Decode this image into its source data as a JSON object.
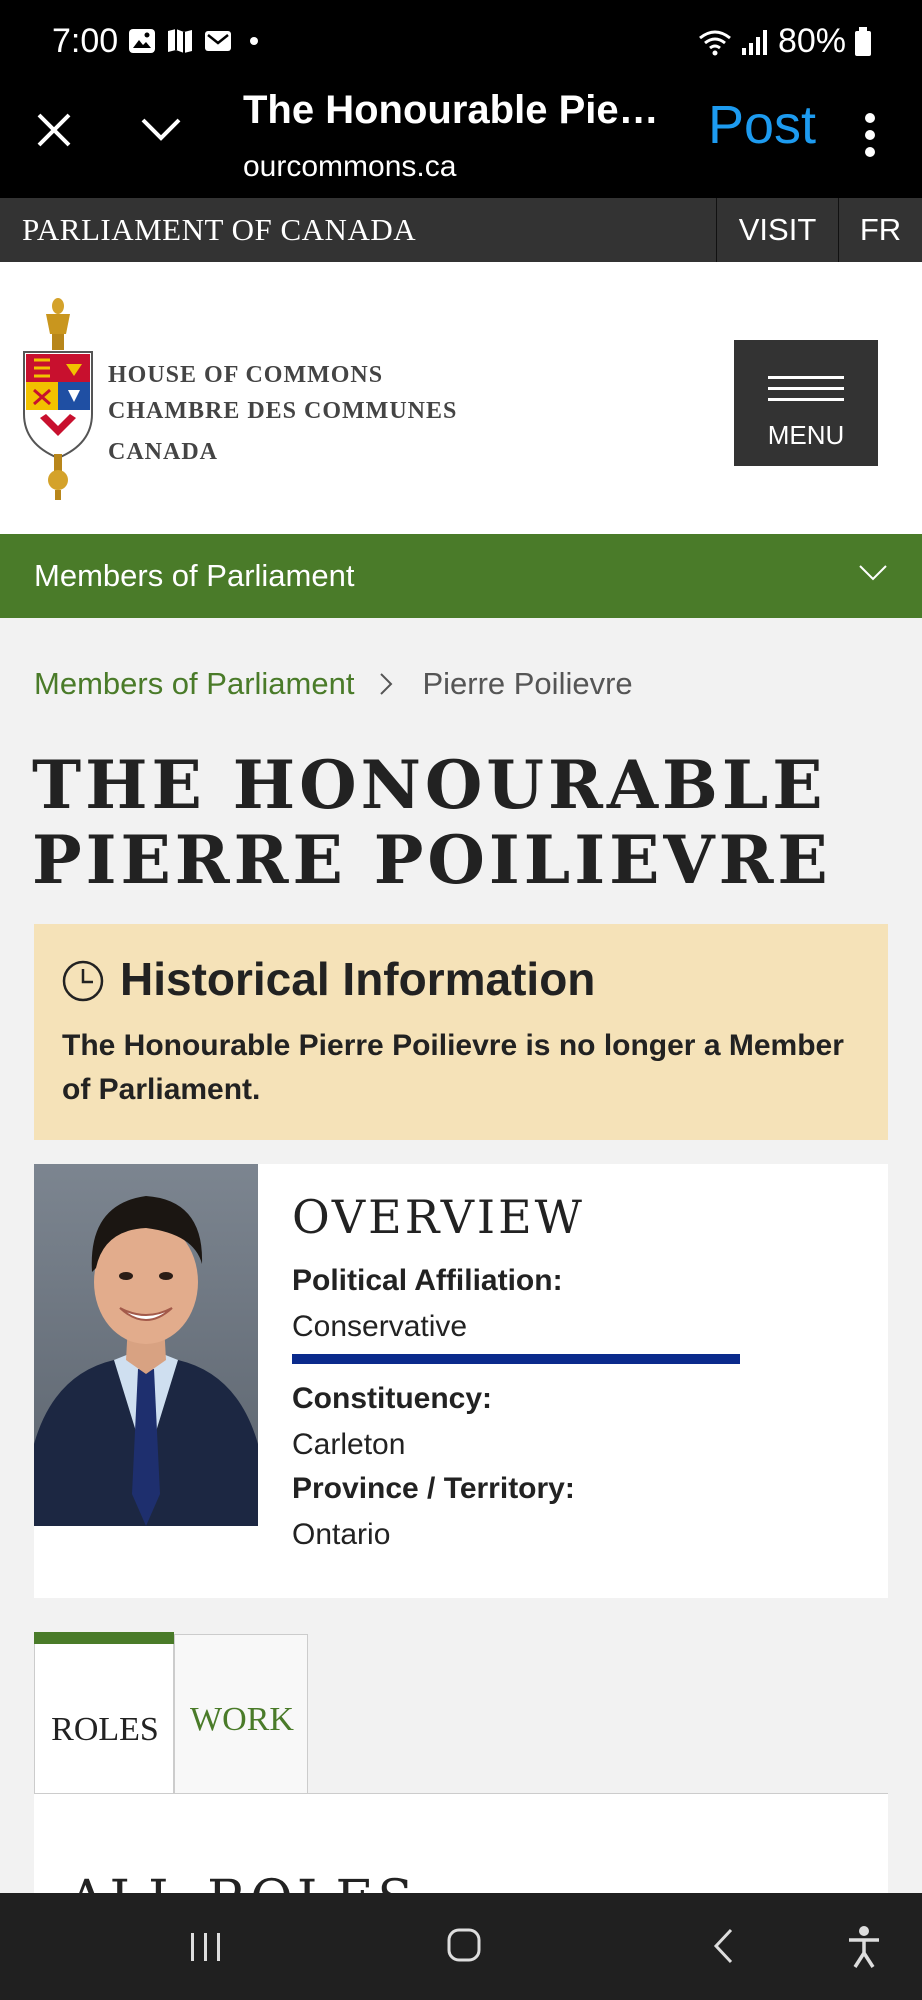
{
  "status_bar": {
    "time": "7:00",
    "battery": "80%",
    "icons": [
      "gallery-icon",
      "map-icon",
      "mail-icon",
      "wifi-icon",
      "signal-icon",
      "battery-icon"
    ]
  },
  "browser": {
    "page_title": "The Honourable Pierr...",
    "domain": "ourcommons.ca",
    "post_label": "Post",
    "accent_color": "#1d9bf0"
  },
  "parliament_bar": {
    "title": "PARLIAMENT OF CANADA",
    "visit_label": "VISIT",
    "lang_label": "FR"
  },
  "header": {
    "line1": "HOUSE OF COMMONS",
    "line2": "CHAMBRE DES COMMUNES",
    "line3": "CANADA",
    "menu_label": "MENU"
  },
  "section_nav": {
    "label": "Members of Parliament",
    "color": "#4a7b29"
  },
  "breadcrumb": {
    "parent": "Members of Parliament",
    "current": "Pierre Poilievre"
  },
  "page": {
    "title_line1": "THE HONOURABLE",
    "title_line2": "PIERRE POILIEVRE"
  },
  "historical": {
    "title": "Historical Information",
    "text": "The Honourable Pierre Poilievre is no longer a Member of Parliament."
  },
  "overview": {
    "heading": "OVERVIEW",
    "affiliation_label": "Political Affiliation:",
    "affiliation_value": "Conservative",
    "party_color": "#0a2a8c",
    "constituency_label": "Constituency:",
    "constituency_value": "Carleton",
    "province_label": "Province / Territory:",
    "province_value": "Ontario"
  },
  "tabs": {
    "roles_label": "ROLES",
    "work_label": "WORK",
    "panel_heading": "ALL ROLES"
  }
}
